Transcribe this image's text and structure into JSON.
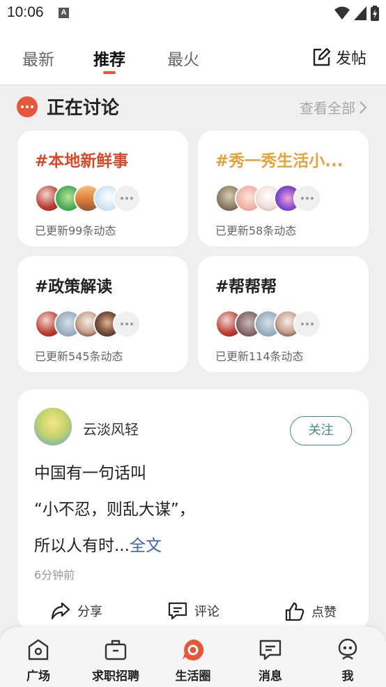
{
  "status_bar": {
    "time": "10:06",
    "notification_badge": "A"
  },
  "header": {
    "tabs": [
      {
        "label": "最新"
      },
      {
        "label": "推荐"
      },
      {
        "label": "最火"
      }
    ],
    "active_tab": "推荐",
    "post_label": "发帖",
    "accent_color": "#e4573a"
  },
  "discussions": {
    "title": "正在讨论",
    "view_all": "查看全部",
    "topics": [
      {
        "title": "#本地新鲜事",
        "title_color": "#d9482b",
        "updated": "已更新99条动态"
      },
      {
        "title": "#秀一秀生活小...",
        "title_color": "#e3a43b",
        "updated": "已更新58条动态"
      },
      {
        "title": "#政策解读",
        "title_color": "#222222",
        "updated": "已更新545条动态"
      },
      {
        "title": "#帮帮帮",
        "title_color": "#222222",
        "updated": "已更新114条动态"
      }
    ]
  },
  "post": {
    "author": "云淡风轻",
    "follow_label": "关注",
    "lines": [
      "中国有一句话叫",
      "“小不忍，则乱大谋”，",
      "所以人有时..."
    ],
    "full_text_link": "全文",
    "time": "6分钟前",
    "actions": {
      "share": "分享",
      "comment": "评论",
      "like": "点赞"
    }
  },
  "bottom_nav": {
    "items": [
      {
        "label": "广场",
        "icon": "square-home-icon"
      },
      {
        "label": "求职招聘",
        "icon": "briefcase-icon"
      },
      {
        "label": "生活圈",
        "icon": "life-circle-icon",
        "active": true
      },
      {
        "label": "消息",
        "icon": "message-icon"
      },
      {
        "label": "我",
        "icon": "profile-icon"
      }
    ]
  }
}
